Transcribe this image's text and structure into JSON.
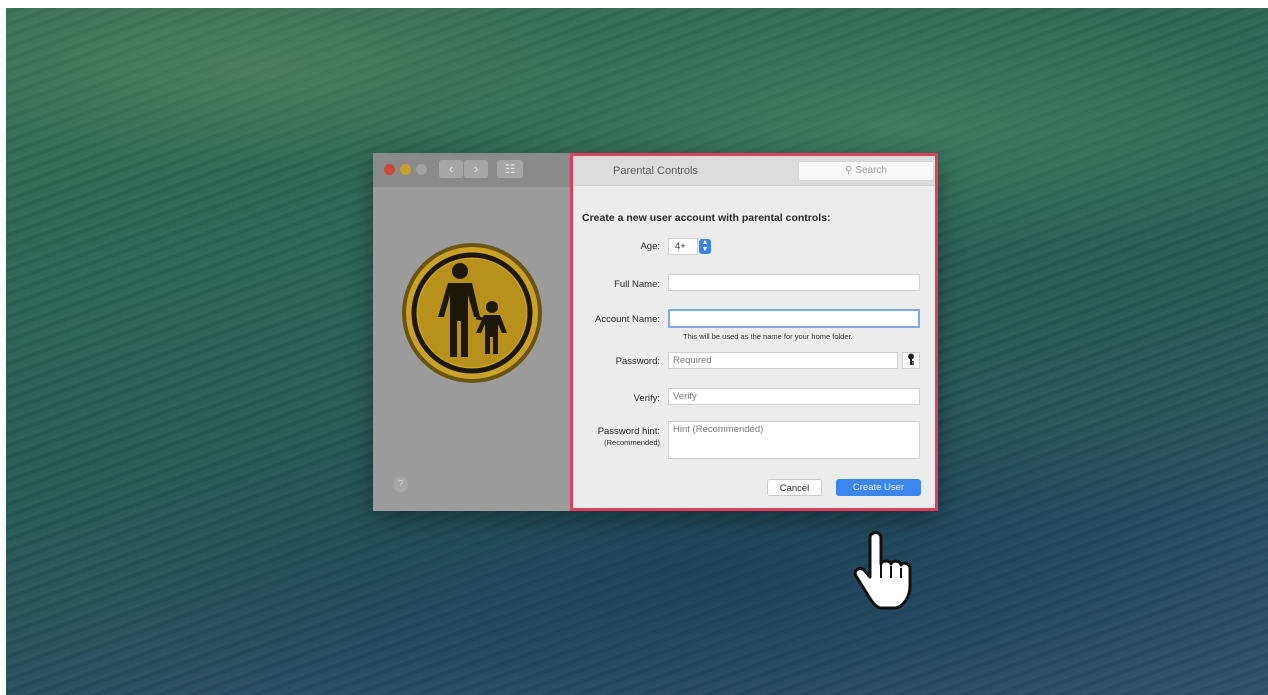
{
  "window": {
    "title": "Parental Controls",
    "search_placeholder": "Search",
    "help_label": "?"
  },
  "form": {
    "heading": "Create a new user account with parental controls:",
    "age_label": "Age:",
    "age_value": "4+",
    "full_name_label": "Full Name:",
    "full_name_value": "",
    "account_name_label": "Account Name:",
    "account_name_value": "",
    "account_name_note": "This will be used as the name for your home folder.",
    "password_label": "Password:",
    "password_placeholder": "Required",
    "verify_label": "Verify:",
    "verify_placeholder": "Verify",
    "hint_label": "Password hint:",
    "hint_label_sub": "(Recommended)",
    "hint_placeholder": "Hint (Recommended)",
    "cancel_label": "Cancel",
    "create_label": "Create User"
  },
  "colors": {
    "highlight_border": "#e0405f",
    "primary_button": "#3b86ef",
    "icon_gold": "#c9a227"
  },
  "icons": {
    "parental_controls": "parent-child-icon",
    "search": "magnifier-icon",
    "password_assistant": "key-icon",
    "cursor": "hand-pointer-icon"
  }
}
